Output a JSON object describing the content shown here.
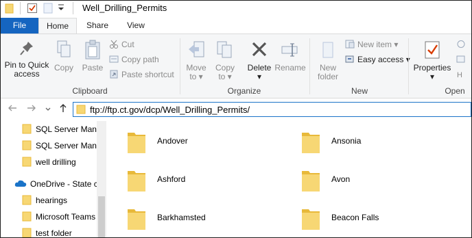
{
  "window": {
    "title": "Well_Drilling_Permits"
  },
  "quick_access": {
    "icons": [
      "folder-icon",
      "properties-check-icon",
      "new-folder-icon",
      "customize-dropdown-icon"
    ]
  },
  "tabs": {
    "file": "File",
    "home": "Home",
    "share": "Share",
    "view": "View"
  },
  "ribbon": {
    "clipboard": {
      "label": "Clipboard",
      "pin_label": "Pin to Quick",
      "pin_label2": "access",
      "copy": "Copy",
      "paste": "Paste",
      "cut": "Cut",
      "copy_path": "Copy path",
      "paste_shortcut": "Paste shortcut"
    },
    "organize": {
      "label": "Organize",
      "move_to": "Move",
      "move_to2": "to",
      "copy_to": "Copy",
      "copy_to2": "to",
      "delete": "Delete",
      "rename": "Rename"
    },
    "new": {
      "label": "New",
      "new_folder": "New",
      "new_folder2": "folder",
      "new_item": "New item",
      "easy_access": "Easy access"
    },
    "open": {
      "label": "Open",
      "properties": "Properties"
    }
  },
  "address": {
    "path": "ftp://ftp.ct.gov/dcp/Well_Drilling_Permits/"
  },
  "navigation_pane": {
    "items": [
      {
        "label": "SQL Server Mana",
        "icon": "folder-icon"
      },
      {
        "label": "SQL Server Mana",
        "icon": "folder-icon"
      },
      {
        "label": "well drilling",
        "icon": "folder-icon"
      },
      {
        "label": "OneDrive - State c",
        "icon": "onedrive-cloud-icon"
      },
      {
        "label": "hearings",
        "icon": "folder-icon"
      },
      {
        "label": "Microsoft Teams",
        "icon": "folder-icon"
      },
      {
        "label": "test folder",
        "icon": "folder-icon"
      }
    ]
  },
  "folders": [
    {
      "name": "Andover"
    },
    {
      "name": "Ansonia"
    },
    {
      "name": "Ashford"
    },
    {
      "name": "Avon"
    },
    {
      "name": "Barkhamsted"
    },
    {
      "name": "Beacon Falls"
    }
  ],
  "colors": {
    "file_tab": "#1565c0",
    "folder": "#f7d774",
    "folder_dark": "#e8b93a",
    "address_border": "#1a73c8"
  }
}
